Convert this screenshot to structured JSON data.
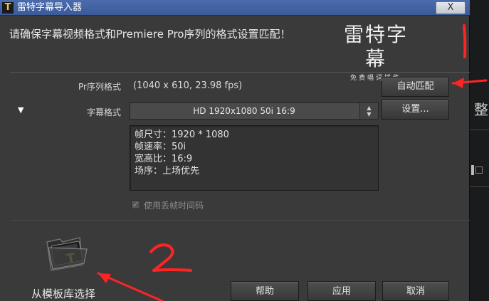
{
  "window": {
    "title": "雷特字幕导入器",
    "close_label": "X"
  },
  "header": {
    "message": "请确保字幕视频格式和Premiere Pro序列的格式设置匹配！"
  },
  "logo": {
    "main": "雷特字幕",
    "sub": "免费唱词插件"
  },
  "sequence": {
    "label": "Pr序列格式",
    "value": "(1040 x 610, 23.98 fps)",
    "auto_match_label": "自动匹配"
  },
  "subtitle_format": {
    "label": "字幕格式",
    "selected": "HD 1920x1080 50i 16:9",
    "settings_label": "设置..."
  },
  "details": {
    "frame_size": "帧尺寸：1920 * 1080",
    "frame_rate": "帧速率：50i",
    "aspect_ratio": "宽高比：16:9",
    "field_order": "场序：上场优先"
  },
  "drop_frame": {
    "label": "使用丢帧时间码",
    "checked": true
  },
  "template": {
    "label": "从模板库选择"
  },
  "footer": {
    "help_label": "帮助",
    "apply_label": "应用",
    "cancel_label": "取消"
  },
  "background": {
    "fragment_text": "整"
  },
  "annotations": {
    "mark_1": "1",
    "mark_2": "2",
    "color": "#ff2424"
  }
}
